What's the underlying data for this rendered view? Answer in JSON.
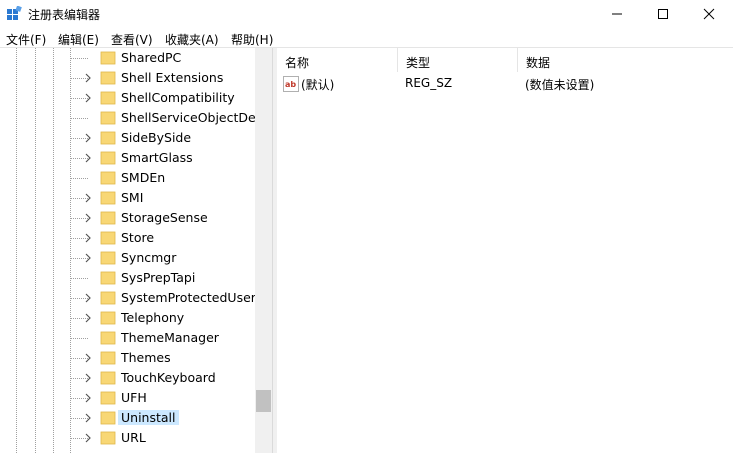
{
  "window": {
    "title": "注册表编辑器",
    "app_icon": "regedit-icon",
    "controls": [
      "minimize-icon",
      "maximize-icon",
      "close-icon"
    ]
  },
  "menu": {
    "items": [
      "文件(F)",
      "编辑(E)",
      "查看(V)",
      "收藏夹(A)",
      "帮助(H)"
    ]
  },
  "tree": {
    "items": [
      {
        "label": "SharedPC",
        "expandable": false
      },
      {
        "label": "Shell Extensions",
        "expandable": true
      },
      {
        "label": "ShellCompatibility",
        "expandable": true
      },
      {
        "label": "ShellServiceObjectDelay",
        "expandable": false
      },
      {
        "label": "SideBySide",
        "expandable": true
      },
      {
        "label": "SmartGlass",
        "expandable": true
      },
      {
        "label": "SMDEn",
        "expandable": false
      },
      {
        "label": "SMI",
        "expandable": true
      },
      {
        "label": "StorageSense",
        "expandable": true
      },
      {
        "label": "Store",
        "expandable": true
      },
      {
        "label": "Syncmgr",
        "expandable": true
      },
      {
        "label": "SysPrepTapi",
        "expandable": false
      },
      {
        "label": "SystemProtectedUserData",
        "expandable": true
      },
      {
        "label": "Telephony",
        "expandable": true
      },
      {
        "label": "ThemeManager",
        "expandable": false
      },
      {
        "label": "Themes",
        "expandable": true
      },
      {
        "label": "TouchKeyboard",
        "expandable": true
      },
      {
        "label": "UFH",
        "expandable": true
      },
      {
        "label": "Uninstall",
        "expandable": true,
        "selected": true
      },
      {
        "label": "URL",
        "expandable": true
      }
    ]
  },
  "list": {
    "headers": {
      "name": "名称",
      "type": "类型",
      "data": "数据"
    },
    "rows": [
      {
        "name": "(默认)",
        "type": "REG_SZ",
        "data": "(数值未设置)",
        "icon": "string-value-icon"
      }
    ]
  },
  "colors": {
    "selection": "#cce8ff",
    "folder": "#f8d775",
    "scroll_thumb": "#c1c1c1"
  }
}
